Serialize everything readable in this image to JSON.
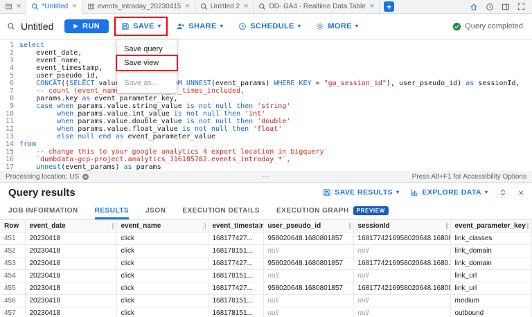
{
  "colors": {
    "accent": "#1a73e8",
    "success": "#1e8e3e",
    "annotation": "#ff0000",
    "keyword": "#1967d2",
    "string": "#c5221f",
    "comment": "#d93025",
    "preview_badge": "#185abc"
  },
  "tabbar": {
    "tabs": [
      {
        "label": "",
        "icon": "grid",
        "active": false
      },
      {
        "label": "*Untitled",
        "icon": "query",
        "active": true
      },
      {
        "label": "events_intraday_20230415",
        "icon": "table",
        "active": false
      },
      {
        "label": "Untitled 2",
        "icon": "query",
        "active": false
      },
      {
        "label": "DD- GA4 - Realtime Data Table",
        "icon": "query",
        "active": false
      }
    ]
  },
  "toolbar": {
    "title": "Untitled",
    "run_label": "RUN",
    "save_label": "SAVE",
    "share_label": "SHARE",
    "schedule_label": "SCHEDULE",
    "more_label": "MORE",
    "status": "Query completed."
  },
  "save_menu": {
    "items": [
      {
        "label": "Save query",
        "enabled": true,
        "annotated": false
      },
      {
        "label": "Save view",
        "enabled": true,
        "annotated": true
      },
      {
        "label": "Save as...",
        "enabled": false,
        "annotated": false
      }
    ]
  },
  "editor": {
    "lines": [
      [
        [
          "kw",
          "select"
        ]
      ],
      [
        [
          "pl",
          "    event_date,"
        ]
      ],
      [
        [
          "pl",
          "    event_name,"
        ]
      ],
      [
        [
          "pl",
          "    event_timestamp,"
        ]
      ],
      [
        [
          "pl",
          "    user_pseudo_id,"
        ]
      ],
      [
        [
          "pl",
          "    "
        ],
        [
          "kw",
          "CONCAT"
        ],
        [
          "pl",
          "(("
        ],
        [
          "kw",
          "SELECT"
        ],
        [
          "pl",
          " value.int_value "
        ],
        [
          "kw",
          "FROM"
        ],
        [
          "pl",
          " "
        ],
        [
          "kw",
          "UNNEST"
        ],
        [
          "pl",
          "(event_params) "
        ],
        [
          "kw",
          "WHERE"
        ],
        [
          "pl",
          " "
        ],
        [
          "kw",
          "KEY"
        ],
        [
          "pl",
          " = "
        ],
        [
          "str",
          "\"ga_session_id\""
        ],
        [
          "pl",
          "), user_pseudo_id) "
        ],
        [
          "kw",
          "as"
        ],
        [
          "pl",
          " sessionId,"
        ]
      ],
      [
        [
          "com",
          "    -- count (event_name) as number_of_times_included,"
        ]
      ],
      [
        [
          "pl",
          "    params.key "
        ],
        [
          "kw",
          "as"
        ],
        [
          "pl",
          " event_parameter_key,"
        ]
      ],
      [
        [
          "pl",
          "    "
        ],
        [
          "kw",
          "case when"
        ],
        [
          "pl",
          " params.value.string_value "
        ],
        [
          "kw",
          "is not null then"
        ],
        [
          "pl",
          " "
        ],
        [
          "str",
          "'string'"
        ]
      ],
      [
        [
          "pl",
          "         "
        ],
        [
          "kw",
          "when"
        ],
        [
          "pl",
          " params.value.int_value "
        ],
        [
          "kw",
          "is not null then"
        ],
        [
          "pl",
          " "
        ],
        [
          "str",
          "'int'"
        ]
      ],
      [
        [
          "pl",
          "         "
        ],
        [
          "kw",
          "when"
        ],
        [
          "pl",
          " params.value.double_value "
        ],
        [
          "kw",
          "is not null then"
        ],
        [
          "pl",
          " "
        ],
        [
          "str",
          "'double'"
        ]
      ],
      [
        [
          "pl",
          "         "
        ],
        [
          "kw",
          "when"
        ],
        [
          "pl",
          " params.value.float_value "
        ],
        [
          "kw",
          "is not null then"
        ],
        [
          "pl",
          " "
        ],
        [
          "str",
          "'float'"
        ]
      ],
      [
        [
          "pl",
          "         "
        ],
        [
          "kw",
          "else null end as"
        ],
        [
          "pl",
          " event_parameter_value"
        ]
      ],
      [
        [
          "kw",
          "from"
        ]
      ],
      [
        [
          "com",
          "    -- change this to your google analytics 4 export location in bigquery"
        ]
      ],
      [
        [
          "str",
          "    `dumbdata-gcp-project.analytics_316185782.events_intraday_*`,"
        ]
      ],
      [
        [
          "pl",
          "    "
        ],
        [
          "kw",
          "unnest"
        ],
        [
          "pl",
          "(event_params) "
        ],
        [
          "kw",
          "as"
        ],
        [
          "pl",
          " params"
        ]
      ]
    ]
  },
  "statusbar": {
    "processing_location": "Processing location: US",
    "accessibility_hint": "Press Alt+F1 for Accessibility Options"
  },
  "results": {
    "title": "Query results",
    "save_results_label": "SAVE RESULTS",
    "explore_data_label": "EXPLORE DATA",
    "tabs": [
      {
        "label": "JOB INFORMATION",
        "active": false
      },
      {
        "label": "RESULTS",
        "active": true
      },
      {
        "label": "JSON",
        "active": false
      },
      {
        "label": "EXECUTION DETAILS",
        "active": false
      },
      {
        "label": "EXECUTION GRAPH",
        "active": false,
        "badge": "PREVIEW"
      }
    ],
    "table": {
      "columns": [
        "Row",
        "event_date",
        "event_name",
        "event_timestamp",
        "user_pseudo_id",
        "sessionId",
        "event_parameter_key"
      ],
      "rows": [
        [
          "451",
          "20230418",
          "click",
          "168177427...",
          "958020648.1680801857",
          "1681774216958020648.16808...",
          "link_classes"
        ],
        [
          "452",
          "20230418",
          "click",
          "168178151...",
          "null",
          "null",
          "link_domain"
        ],
        [
          "453",
          "20230418",
          "click",
          "168177427...",
          "958020648.1680801857",
          "1681774216958020648.1680...",
          "link_domain"
        ],
        [
          "454",
          "20230418",
          "click",
          "168178151...",
          "null",
          "null",
          "link_url"
        ],
        [
          "455",
          "20230418",
          "click",
          "168177427...",
          "958020648.1680801857",
          "1681774216958020648.16808...",
          "link_url"
        ],
        [
          "456",
          "20230418",
          "click",
          "168178151...",
          "null",
          "null",
          "medium"
        ],
        [
          "457",
          "20230418",
          "click",
          "168178151...",
          "null",
          "null",
          "outbound"
        ]
      ]
    }
  }
}
